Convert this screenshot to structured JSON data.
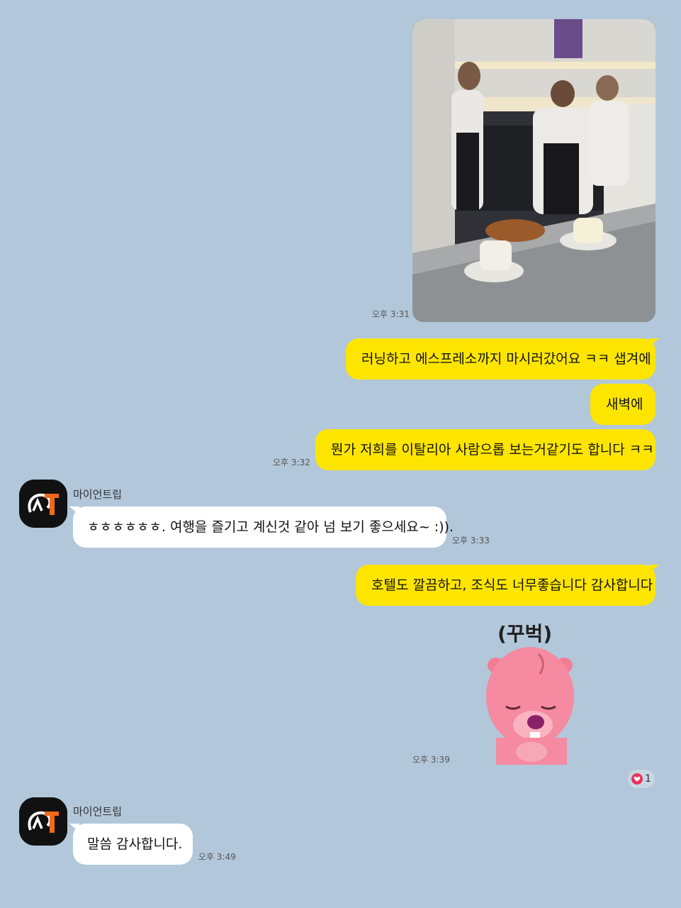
{
  "chat": {
    "contact_name": "마이언트립",
    "messages": [
      {
        "id": "m1",
        "type": "photo",
        "sender": "me",
        "time": "오후 3:31"
      },
      {
        "id": "m2",
        "sender": "me",
        "text": "러닝하고 에스프레소까지 마시러갔어요 ㅋㅋ 샙겨에"
      },
      {
        "id": "m3",
        "sender": "me",
        "text": "새벽에"
      },
      {
        "id": "m4",
        "sender": "me",
        "text": "뭔가 저희를 이탈리아 사람으롭 보는거같기도 합니다 ㅋㅋ",
        "time": "오후 3:32"
      },
      {
        "id": "m5",
        "sender": "them",
        "text": "ㅎㅎㅎㅎㅎㅎ. 여행을 즐기고 계신것 같아 넘 보기 좋으세요~ :)).",
        "time": "오후 3:33"
      },
      {
        "id": "m6",
        "sender": "me",
        "text": "호텔도 깔끔하고, 조식도 너무좋습니다 감사합니다"
      },
      {
        "id": "m7",
        "type": "sticker",
        "sender": "me",
        "sticker_caption": "(꾸벅)",
        "time": "오후 3:39",
        "reaction_icon": "heart-icon",
        "reaction_count": "1"
      },
      {
        "id": "m8",
        "sender": "them",
        "text": "말씀 감사합니다.",
        "time": "오후 3:49"
      }
    ]
  },
  "colors": {
    "background": "#b2c7da",
    "my_bubble": "#fee500",
    "their_bubble": "#ffffff",
    "reaction_heart": "#e8325a"
  }
}
